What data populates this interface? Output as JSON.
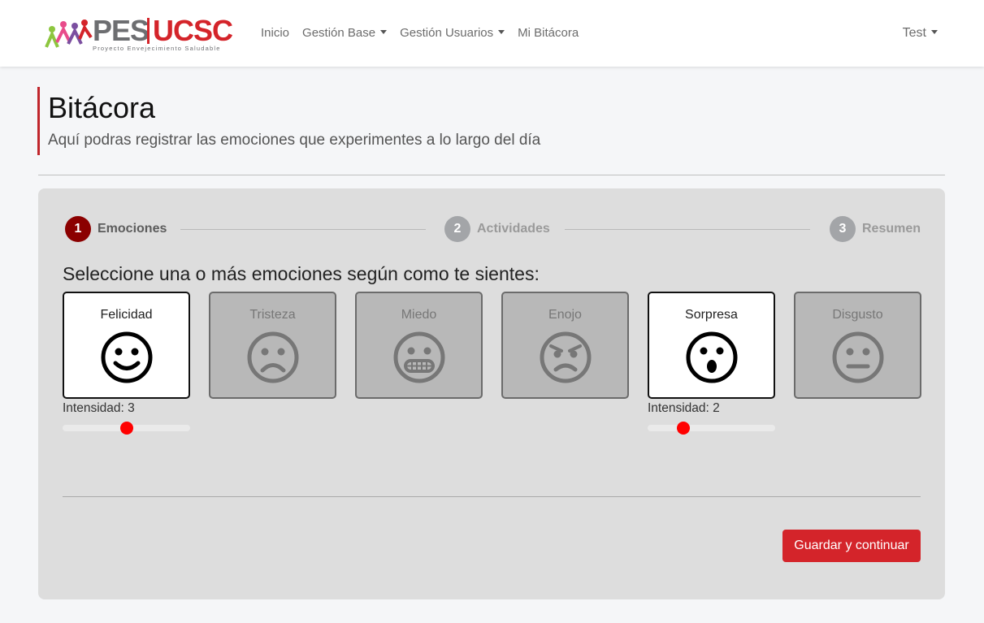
{
  "brand": {
    "primary": "PES",
    "secondary": "UCSC",
    "tagline": "Proyecto Envejecimiento Saludable",
    "colors": {
      "red": "#d4242a",
      "gray": "#6d6e71"
    }
  },
  "nav": {
    "items": [
      "Inicio",
      "Gestión Base",
      "Gestión Usuarios",
      "Mi Bitácora"
    ],
    "user": "Test"
  },
  "header": {
    "title": "Bitácora",
    "subtitle": "Aquí podras registrar las emociones que experimentes a lo largo del día"
  },
  "stepper": [
    {
      "number": "1",
      "label": "Emociones",
      "active": true
    },
    {
      "number": "2",
      "label": "Actividades",
      "active": false
    },
    {
      "number": "3",
      "label": "Resumen",
      "active": false
    }
  ],
  "question": "Seleccione una o más emociones según como te sientes:",
  "emotions": [
    {
      "name": "Felicidad",
      "icon": "happy-face-icon",
      "selected": true,
      "intensity_label": "Intensidad: 3",
      "intensity": 3
    },
    {
      "name": "Tristeza",
      "icon": "sad-face-icon",
      "selected": false
    },
    {
      "name": "Miedo",
      "icon": "grimace-face-icon",
      "selected": false
    },
    {
      "name": "Enojo",
      "icon": "angry-face-icon",
      "selected": false
    },
    {
      "name": "Sorpresa",
      "icon": "surprised-face-icon",
      "selected": true,
      "intensity_label": "Intensidad: 2",
      "intensity": 2
    },
    {
      "name": "Disgusto",
      "icon": "neutral-face-icon",
      "selected": false
    }
  ],
  "intensity_scale": {
    "min": 1,
    "max": 5
  },
  "actions": {
    "save_label": "Guardar y continuar"
  },
  "colors": {
    "accent": "#d4242a",
    "step_active": "#8b0000",
    "step_inactive": "#a3a5a8",
    "slider_thumb": "#ff0000"
  }
}
